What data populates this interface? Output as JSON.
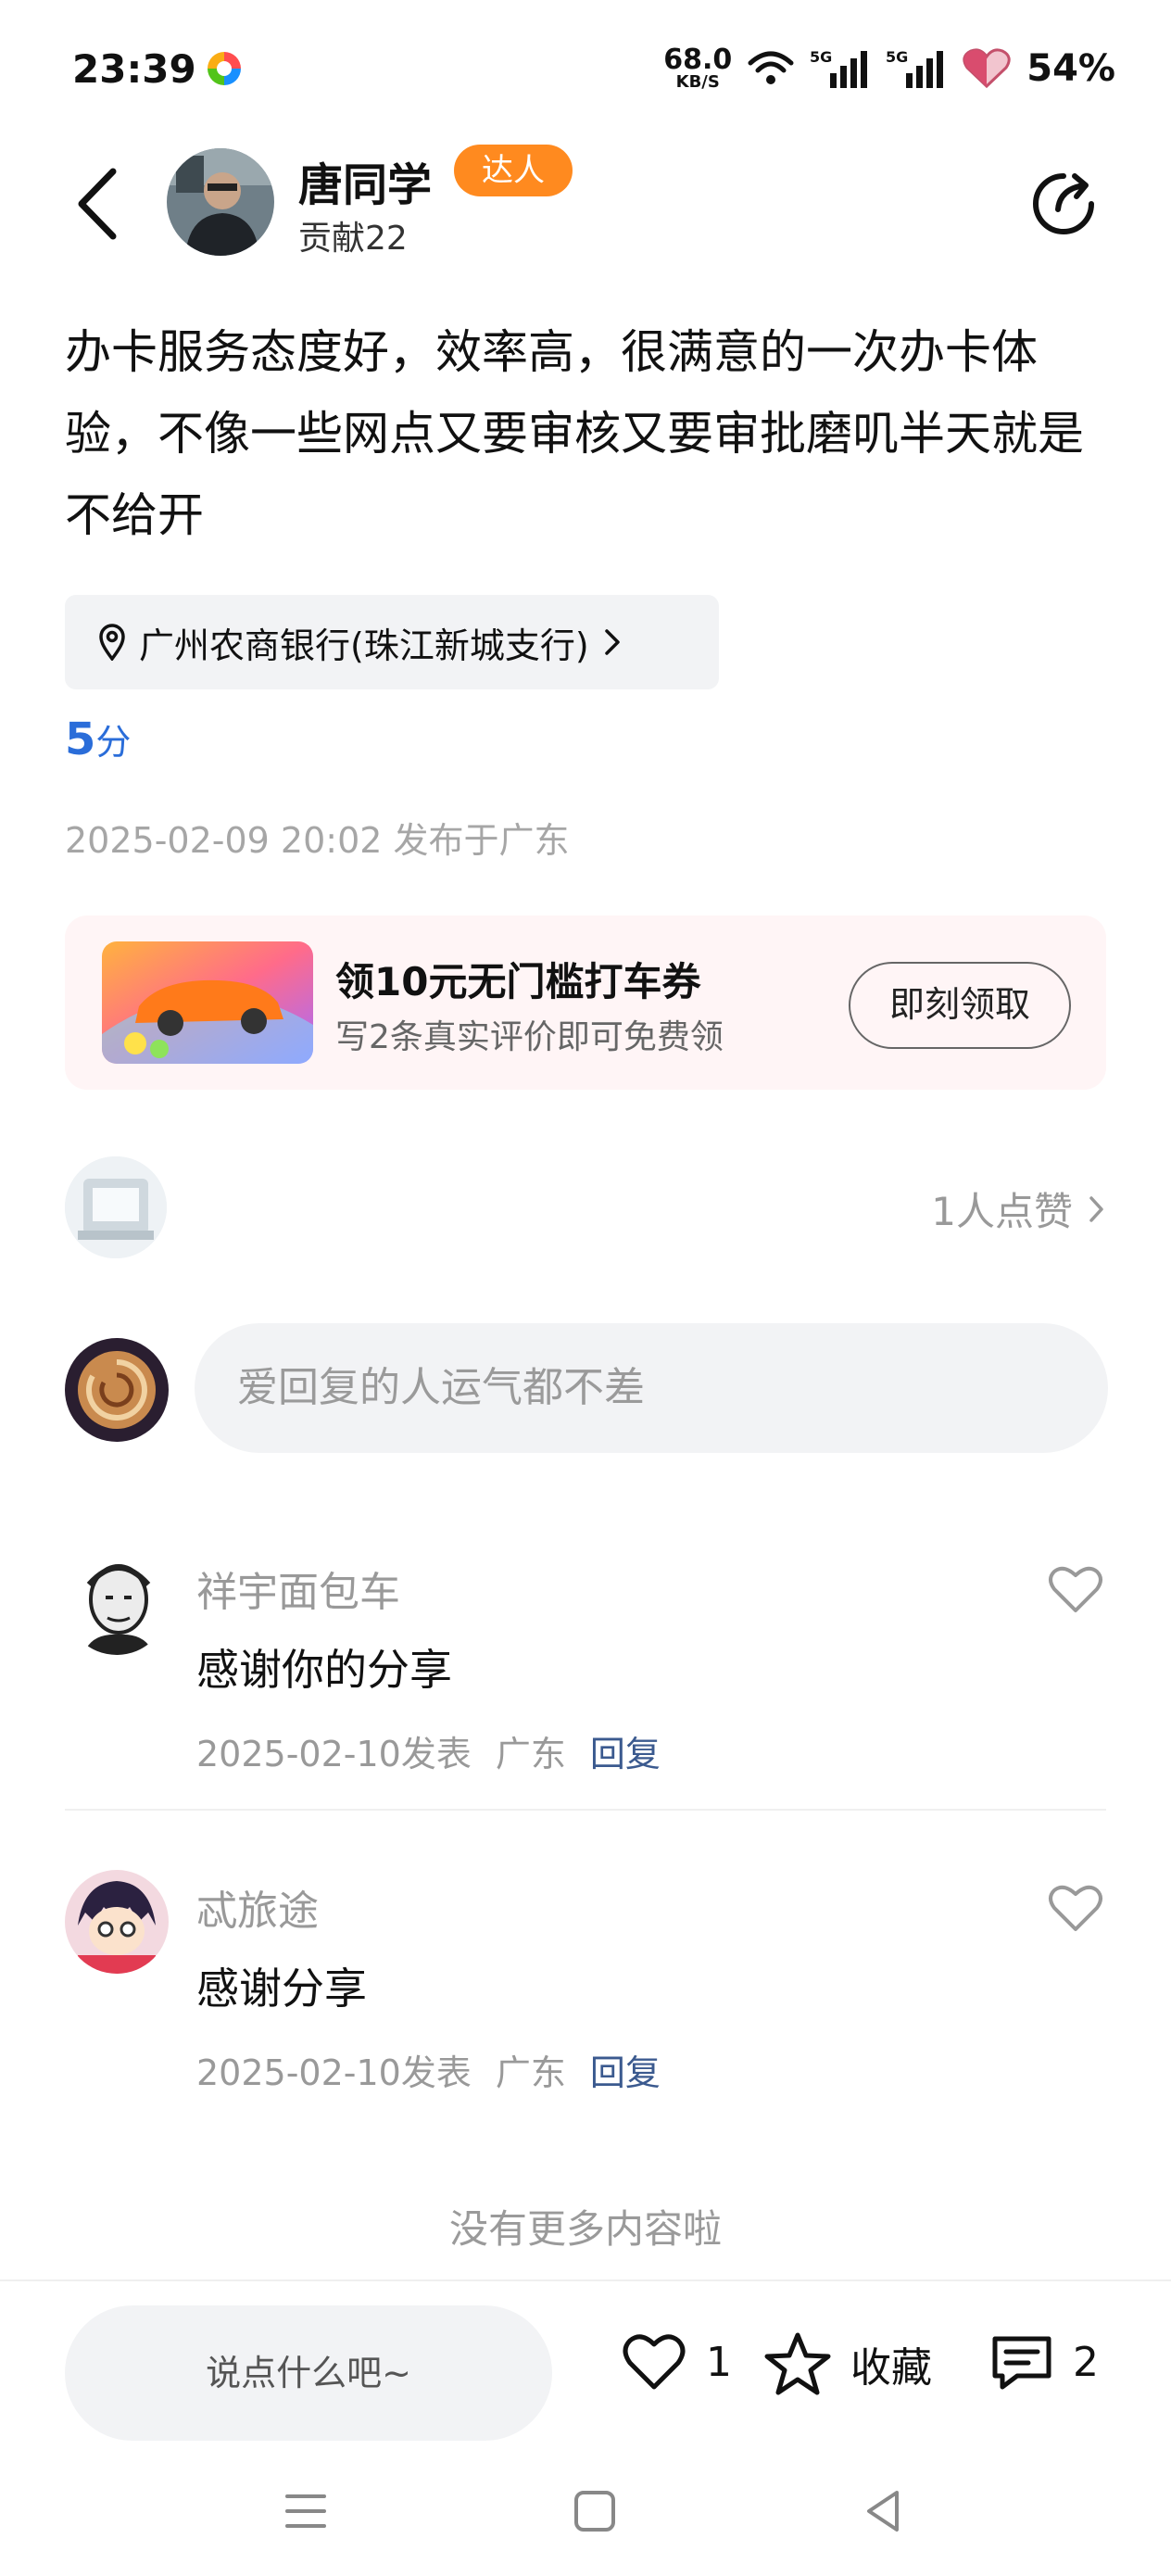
{
  "status_bar": {
    "time": "23:39",
    "net_speed_value": "68.0",
    "net_speed_unit": "KB/S",
    "signal1_label": "5G",
    "signal2_label": "5G",
    "battery": "54%"
  },
  "header": {
    "author_name": "唐同学",
    "author_badge": "达人",
    "author_contribution": "贡献22"
  },
  "post": {
    "text": "办卡服务态度好，效率高，很满意的一次办卡体验，不像一些网点又要审核又要审批磨叽半天就是不给开",
    "location": "广州农商银行(珠江新城支行)",
    "score_value": "5",
    "score_unit": "分",
    "meta": "2025-02-09 20:02 发布于广东"
  },
  "promo": {
    "title": "领10元无门槛打车券",
    "subtitle": "写2条真实评价即可免费领",
    "button": "即刻领取"
  },
  "likes": {
    "label": "1人点赞"
  },
  "reply_box": {
    "placeholder": "爱回复的人运气都不差"
  },
  "comments": [
    {
      "user": "祥宇面包车",
      "text": "感谢你的分享",
      "date": "2025-02-10发表",
      "region": "广东",
      "reply": "回复"
    },
    {
      "user": "忒旅途",
      "text": "感谢分享",
      "date": "2025-02-10发表",
      "region": "广东",
      "reply": "回复"
    }
  ],
  "footer_note": "没有更多内容啦",
  "bottom_bar": {
    "say_placeholder": "说点什么吧~",
    "like_count": "1",
    "collect_label": "收藏",
    "comment_count": "2"
  },
  "colors": {
    "accent_blue": "#2a6dd9",
    "badge_orange": "#ff8a1f",
    "reply_link": "#3b5a8f"
  }
}
